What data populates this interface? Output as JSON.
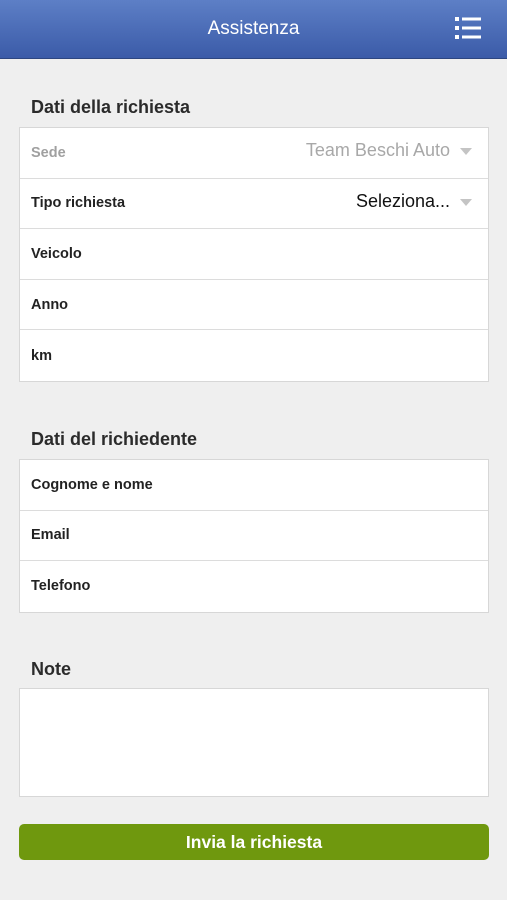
{
  "header": {
    "title": "Assistenza",
    "menu_icon": "list-menu-icon"
  },
  "request_section": {
    "title": "Dati della richiesta",
    "fields": {
      "sede": {
        "label": "Sede",
        "value": "Team Beschi Auto"
      },
      "tipo": {
        "label": "Tipo richiesta",
        "value": "Seleziona..."
      },
      "veicolo": {
        "label": "Veicolo"
      },
      "anno": {
        "label": "Anno"
      },
      "km": {
        "label": "km"
      }
    }
  },
  "requester_section": {
    "title": "Dati del richiedente",
    "fields": {
      "nome": {
        "label": "Cognome e nome"
      },
      "email": {
        "label": "Email"
      },
      "telefono": {
        "label": "Telefono"
      }
    }
  },
  "note_section": {
    "title": "Note",
    "value": ""
  },
  "submit": {
    "label": "Invia la richiesta"
  },
  "colors": {
    "header": "#3b5ba8",
    "submit": "#6f980e",
    "background": "#efefef"
  }
}
